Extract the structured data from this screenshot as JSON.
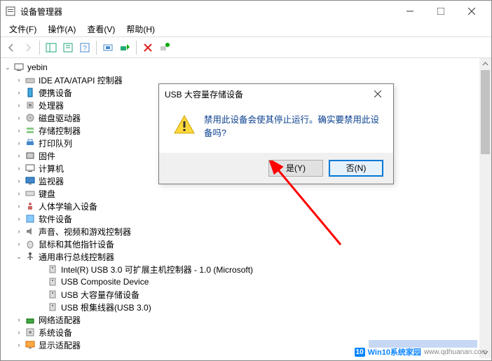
{
  "window": {
    "title": "设备管理器",
    "min": "—",
    "max": "☐",
    "close": "✕"
  },
  "menu": {
    "file": "文件(F)",
    "action": "操作(A)",
    "view": "查看(V)",
    "help": "帮助(H)"
  },
  "tree": {
    "root": "yebin",
    "items": [
      {
        "label": "IDE ATA/ATAPI 控制器",
        "icon": "ide"
      },
      {
        "label": "便携设备",
        "icon": "portable"
      },
      {
        "label": "处理器",
        "icon": "cpu"
      },
      {
        "label": "磁盘驱动器",
        "icon": "disk"
      },
      {
        "label": "存储控制器",
        "icon": "storage"
      },
      {
        "label": "打印队列",
        "icon": "print"
      },
      {
        "label": "固件",
        "icon": "firmware"
      },
      {
        "label": "计算机",
        "icon": "computer"
      },
      {
        "label": "监视器",
        "icon": "monitor"
      },
      {
        "label": "键盘",
        "icon": "keyboard"
      },
      {
        "label": "人体学输入设备",
        "icon": "hid"
      },
      {
        "label": "软件设备",
        "icon": "software"
      },
      {
        "label": "声音、视频和游戏控制器",
        "icon": "sound"
      },
      {
        "label": "鼠标和其他指针设备",
        "icon": "mouse"
      },
      {
        "label": "通用串行总线控制器",
        "icon": "usb",
        "expanded": true,
        "children": [
          {
            "label": "Intel(R) USB 3.0 可扩展主机控制器 - 1.0 (Microsoft)"
          },
          {
            "label": "USB Composite Device"
          },
          {
            "label": "USB 大容量存储设备"
          },
          {
            "label": "USB 根集线器(USB 3.0)"
          }
        ]
      },
      {
        "label": "网络适配器",
        "icon": "network"
      },
      {
        "label": "系统设备",
        "icon": "system"
      },
      {
        "label": "显示适配器",
        "icon": "display"
      }
    ]
  },
  "dialog": {
    "title": "USB 大容量存储设备",
    "message": "禁用此设备会使其停止运行。确实要禁用此设备吗?",
    "yes": "是(Y)",
    "no": "否(N)"
  },
  "watermark": {
    "badge": "10",
    "text": "Win10系统家园",
    "url": "www.qdhuanan.com"
  }
}
